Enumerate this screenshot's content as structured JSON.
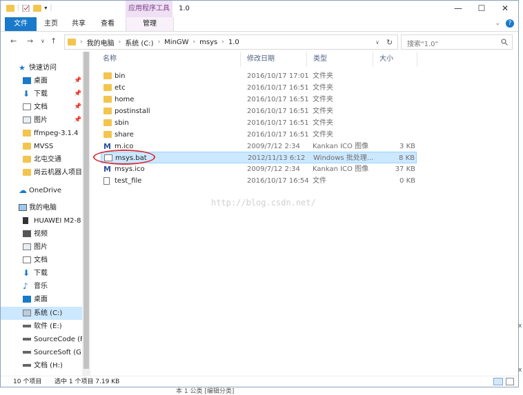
{
  "window": {
    "title": "1.0",
    "contextual_tab": "应用程序工具",
    "controls": {
      "minimize": "—",
      "maximize": "☐",
      "close": "✕"
    }
  },
  "ribbon": {
    "tabs": [
      "文件",
      "主页",
      "共享",
      "查看",
      "管理"
    ],
    "help": "?"
  },
  "address": {
    "breadcrumbs": [
      "我的电脑",
      "系统 (C:)",
      "MinGW",
      "msys",
      "1.0"
    ],
    "search_placeholder": "搜索\"1.0\""
  },
  "sidebar": {
    "quick_access": "快速访问",
    "quick_items": [
      "桌面",
      "下载",
      "文档",
      "图片",
      "ffmpeg-3.1.4",
      "MVSS",
      "北屯交通",
      "尚云机器人项目"
    ],
    "onedrive": "OneDrive",
    "this_pc": "我的电脑",
    "pc_items": [
      "HUAWEI M2-8",
      "视频",
      "图片",
      "文档",
      "下载",
      "音乐",
      "桌面",
      "系统 (C:)",
      "软件 (E:)",
      "SourceCode (F",
      "SourceSoft (G:)",
      "文档 (H:)"
    ]
  },
  "columns": {
    "name": "名称",
    "date": "修改日期",
    "type": "类型",
    "size": "大小"
  },
  "files": [
    {
      "name": "bin",
      "date": "2016/10/17 17:01",
      "type": "文件夹",
      "size": "",
      "icon": "folder-icon"
    },
    {
      "name": "etc",
      "date": "2016/10/17 16:51",
      "type": "文件夹",
      "size": "",
      "icon": "folder-icon"
    },
    {
      "name": "home",
      "date": "2016/10/17 16:51",
      "type": "文件夹",
      "size": "",
      "icon": "folder-icon"
    },
    {
      "name": "postinstall",
      "date": "2016/10/17 16:51",
      "type": "文件夹",
      "size": "",
      "icon": "folder-icon"
    },
    {
      "name": "sbin",
      "date": "2016/10/17 16:51",
      "type": "文件夹",
      "size": "",
      "icon": "folder-icon"
    },
    {
      "name": "share",
      "date": "2016/10/17 16:51",
      "type": "文件夹",
      "size": "",
      "icon": "folder-icon"
    },
    {
      "name": "m.ico",
      "date": "2009/7/12 2:34",
      "type": "Kankan ICO 图像",
      "size": "3 KB",
      "icon": "ico-icon"
    },
    {
      "name": "msys.bat",
      "date": "2012/11/13 6:12",
      "type": "Windows 批处理...",
      "size": "8 KB",
      "icon": "batch-file-icon"
    },
    {
      "name": "msys.ico",
      "date": "2009/7/12 2:34",
      "type": "Kankan ICO 图像",
      "size": "37 KB",
      "icon": "ico-icon"
    },
    {
      "name": "test_file",
      "date": "2016/10/17 16:54",
      "type": "文件",
      "size": "0 KB",
      "icon": "file-icon"
    }
  ],
  "watermark": "http://blog.csdn.net/",
  "status": {
    "count": "10 个项目",
    "selected": "选中 1 个项目  7.19 KB"
  },
  "below_window": "本 1 公类 [编辑分类]",
  "edge_chars": [
    "x",
    "x"
  ]
}
